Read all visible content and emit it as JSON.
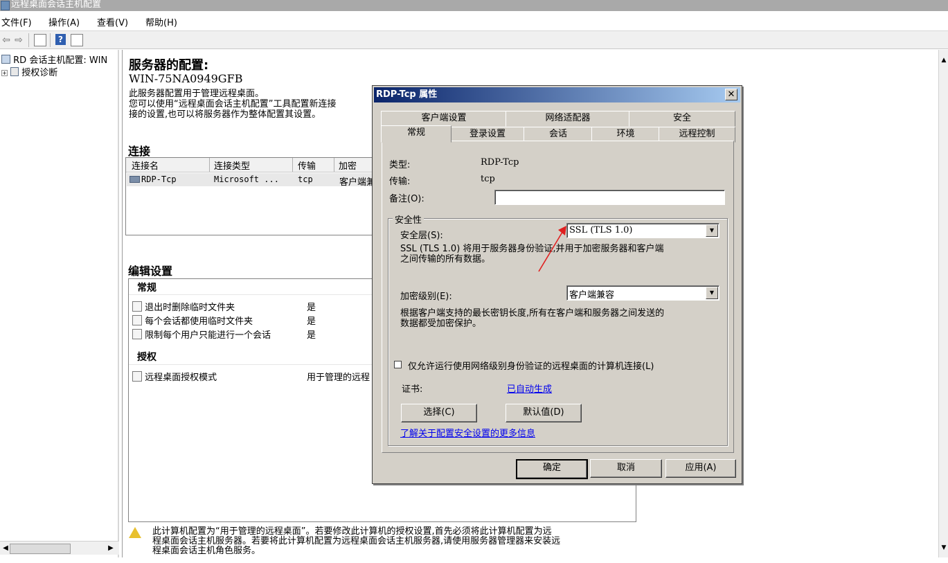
{
  "window": {
    "title": "远程桌面会话主机配置"
  },
  "menu": [
    "文件(F)",
    "操作(A)",
    "查看(V)",
    "帮助(H)"
  ],
  "tree": {
    "items": [
      {
        "label": "RD 会话主机配置: WIN"
      },
      {
        "label": "授权诊断"
      }
    ]
  },
  "content": {
    "heading": "服务器的配置:",
    "server_name": "WIN-75NA0949GFB",
    "description_lines": [
      "此服务器配置用于管理远程桌面。",
      "您可以使用“远程桌面会话主机配置”工具配置新连接",
      "接的设置,也可以将服务器作为整体配置其设置。"
    ],
    "connections": {
      "title": "连接",
      "columns": [
        "连接名",
        "连接类型",
        "传输",
        "加密"
      ],
      "rows": [
        {
          "name": "RDP-Tcp",
          "type": "Microsoft ...",
          "transport": "tcp",
          "encryption": "客户端兼"
        }
      ]
    },
    "edit_settings": {
      "title": "编辑设置",
      "general_title": "常规",
      "general_items": [
        {
          "label": "退出时删除临时文件夹",
          "value": "是"
        },
        {
          "label": "每个会话都使用临时文件夹",
          "value": "是"
        },
        {
          "label": "限制每个用户只能进行一个会话",
          "value": "是"
        }
      ],
      "licensing_title": "授权",
      "licensing_items": [
        {
          "label": "远程桌面授权模式",
          "value": "用于管理的远程"
        }
      ]
    },
    "warning_lines": [
      "此计算机配置为“用于管理的远程桌面”。若要修改此计算机的授权设置,首先必须将此计算机配置为远",
      "程桌面会话主机服务器。若要将此计算机配置为远程桌面会话主机服务器,请使用服务器管理器来安装远",
      "程桌面会话主机角色服务。"
    ]
  },
  "dialog": {
    "title": "RDP-Tcp 属性",
    "close_glyph": "✕",
    "tabs_back": [
      "客户端设置",
      "网络适配器",
      "安全"
    ],
    "tabs_front": [
      "常规",
      "登录设置",
      "会话",
      "环境",
      "远程控制"
    ],
    "type_label": "类型:",
    "type_value": "RDP-Tcp",
    "transport_label": "传输:",
    "transport_value": "tcp",
    "comment_label": "备注(O):",
    "comment_value": "",
    "security_group": "安全性",
    "security_layer_label": "安全层(S):",
    "security_layer_value": "SSL (TLS 1.0)",
    "security_layer_desc": [
      "SSL (TLS 1.0) 将用于服务器身份验证,并用于加密服务器和客户端",
      "之间传输的所有数据。"
    ],
    "encryption_label": "加密级别(E):",
    "encryption_value": "客户端兼容",
    "encryption_desc": [
      "根据客户端支持的最长密钥长度,所有在客户端和服务器之间发送的",
      "数据都受加密保护。"
    ],
    "nla_checkbox": "仅允许运行使用网络级别身份验证的远程桌面的计算机连接(L)",
    "cert_label": "证书:",
    "cert_value": "已自动生成",
    "select_button": "选择(C)",
    "default_button": "默认值(D)",
    "learn_more_link": "了解关于配置安全设置的更多信息",
    "ok_button": "确定",
    "cancel_button": "取消",
    "apply_button": "应用(A)"
  },
  "colors": {
    "dialog_face": "#d4d0c8",
    "dialog_title": "#0a246a",
    "link": "#0000ee",
    "annotation_arrow": "#e02020"
  }
}
